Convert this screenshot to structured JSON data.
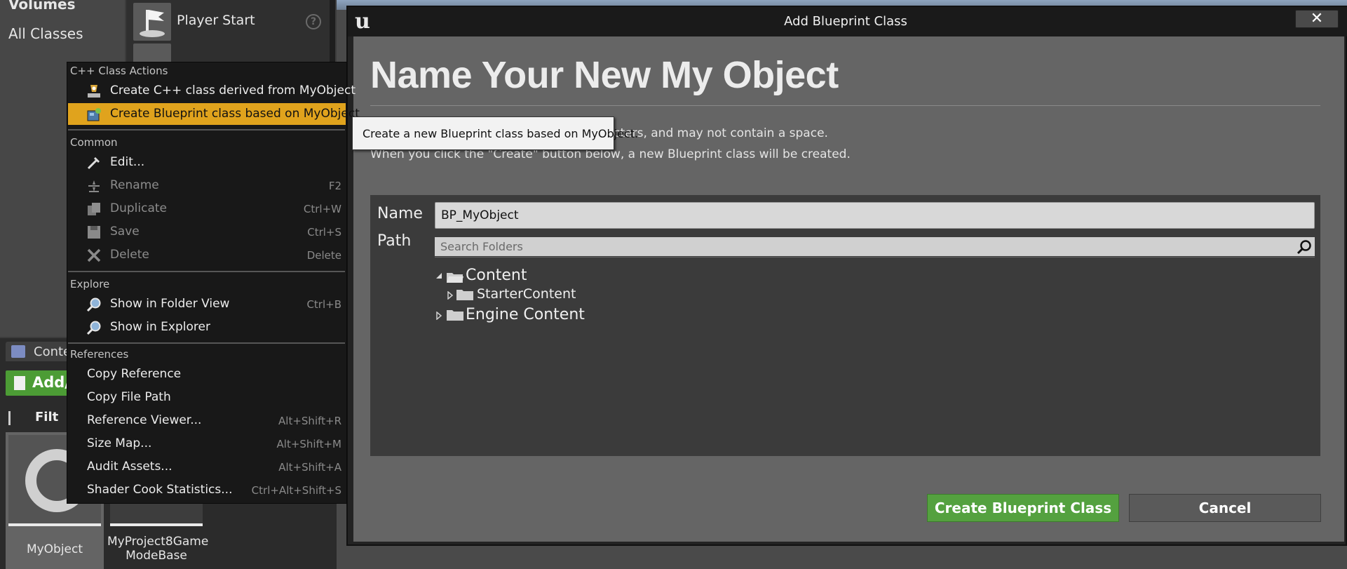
{
  "background": {
    "categories": [
      "Volumes",
      "All Classes"
    ],
    "placeables": [
      {
        "label": "Player Start",
        "icon": "player-start-icon"
      }
    ],
    "help_glyph": "?",
    "content_browser": {
      "tab_label": "Conte",
      "add_new_label": "Add/",
      "filters_label": "Filt",
      "assets": [
        {
          "label": "MyObject"
        },
        {
          "label_line1": "MyProject8Game",
          "label_line2": "ModeBase"
        }
      ]
    }
  },
  "dialog": {
    "title": "Add Blueprint Class",
    "close_glyph": "✕",
    "heading": "Name Your New My Object",
    "description_line1": "es may only contain alphanumeric characters, and may not contain a space.",
    "description_line2": "When you click the \"Create\" button below, a new Blueprint class will be created.",
    "name_label": "Name",
    "name_value": "BP_MyObject",
    "path_label": "Path",
    "search_placeholder": "Search Folders",
    "tree": {
      "content": "Content",
      "starter_content": "StarterContent",
      "engine_content": "Engine Content"
    },
    "create_button": "Create Blueprint Class",
    "cancel_button": "Cancel",
    "colors": {
      "create": "#54a13f",
      "panel": "#3b3b3b",
      "body": "#656565"
    }
  },
  "context_menu": {
    "sections": {
      "cpp": "C++ Class Actions",
      "common": "Common",
      "explore": "Explore",
      "references": "References"
    },
    "cpp_items": [
      {
        "label": "Create C++ class derived from MyObject",
        "icon": "cpp-class-icon"
      },
      {
        "label": "Create Blueprint class based on MyObject",
        "icon": "blueprint-class-icon",
        "highlighted": true
      }
    ],
    "common_items": [
      {
        "label": "Edit...",
        "icon": "edit-icon",
        "shortcut": ""
      },
      {
        "label": "Rename",
        "icon": "rename-icon",
        "shortcut": "F2",
        "disabled": true
      },
      {
        "label": "Duplicate",
        "icon": "duplicate-icon",
        "shortcut": "Ctrl+W",
        "disabled": true
      },
      {
        "label": "Save",
        "icon": "save-icon",
        "shortcut": "Ctrl+S",
        "disabled": true
      },
      {
        "label": "Delete",
        "icon": "delete-icon",
        "shortcut": "Delete",
        "disabled": true
      }
    ],
    "explore_items": [
      {
        "label": "Show in Folder View",
        "icon": "folder-search-icon",
        "shortcut": "Ctrl+B"
      },
      {
        "label": "Show in Explorer",
        "icon": "explorer-search-icon",
        "shortcut": ""
      }
    ],
    "reference_items": [
      {
        "label": "Copy Reference",
        "shortcut": ""
      },
      {
        "label": "Copy File Path",
        "shortcut": ""
      },
      {
        "label": "Reference Viewer...",
        "shortcut": "Alt+Shift+R"
      },
      {
        "label": "Size Map...",
        "shortcut": "Alt+Shift+M"
      },
      {
        "label": "Audit Assets...",
        "shortcut": "Alt+Shift+A"
      },
      {
        "label": "Shader Cook Statistics...",
        "shortcut": "Ctrl+Alt+Shift+S"
      }
    ],
    "highlight_color": "#e0a31d"
  },
  "tooltip": {
    "text": "Create a new Blueprint class based on MyObject."
  }
}
